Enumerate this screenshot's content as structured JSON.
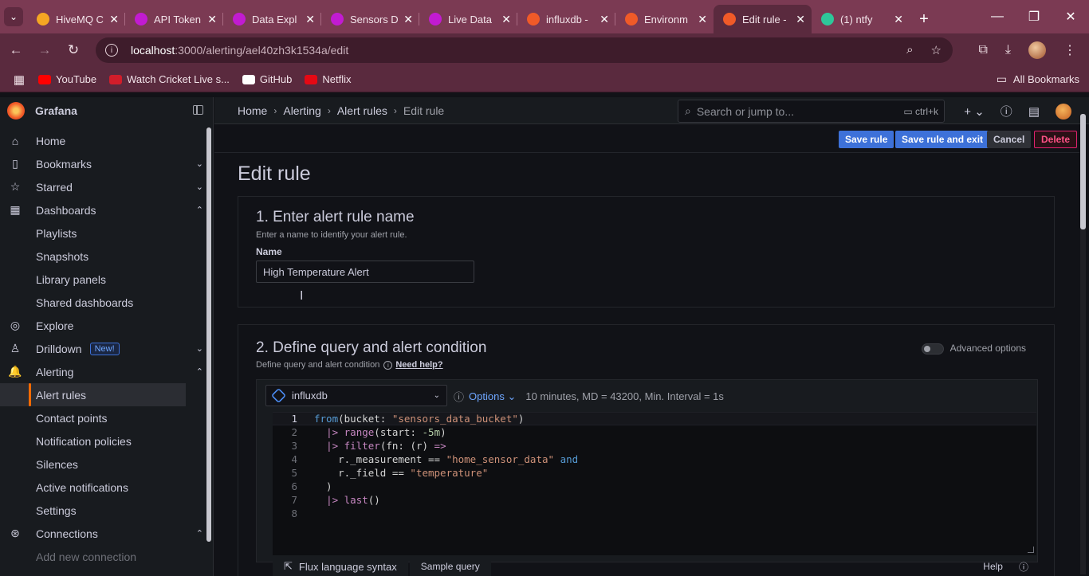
{
  "browser": {
    "tabs": [
      {
        "title": "HiveMQ C",
        "color": "#f5a623"
      },
      {
        "title": "API Token",
        "color": "#c21bd1"
      },
      {
        "title": "Data Expl",
        "color": "#c21bd1"
      },
      {
        "title": "Sensors D",
        "color": "#c21bd1"
      },
      {
        "title": "Live Data",
        "color": "#c21bd1"
      },
      {
        "title": "influxdb -",
        "color": "#f05a28"
      },
      {
        "title": "Environm",
        "color": "#f05a28"
      },
      {
        "title": "Edit rule -",
        "color": "#f05a28"
      },
      {
        "title": "(1) ntfy",
        "color": "#2ec79a"
      }
    ],
    "url_host": "localhost",
    "url_path": ":3000/alerting/ael40zh3k1534a/edit",
    "bookmarks": [
      {
        "label": "YouTube",
        "color": "#ff0000"
      },
      {
        "label": "Watch Cricket Live s...",
        "color": "#d11d2a"
      },
      {
        "label": "GitHub",
        "color": "#ffffff"
      },
      {
        "label": "Netflix",
        "color": "#e50914"
      }
    ],
    "all_bookmarks": "All Bookmarks"
  },
  "grafana": {
    "app_title": "Grafana",
    "sidebar": [
      {
        "label": "Home",
        "icon": "home-icon",
        "glyph": "⌂",
        "level": 0,
        "chev": ""
      },
      {
        "label": "Bookmarks",
        "icon": "bookmark-icon",
        "glyph": "▯",
        "level": 0,
        "chev": "⌄"
      },
      {
        "label": "Starred",
        "icon": "star-icon",
        "glyph": "☆",
        "level": 0,
        "chev": "⌄"
      },
      {
        "label": "Dashboards",
        "icon": "dashboards-icon",
        "glyph": "▦",
        "level": 0,
        "chev": "⌃"
      },
      {
        "label": "Playlists",
        "level": 1
      },
      {
        "label": "Snapshots",
        "level": 1
      },
      {
        "label": "Library panels",
        "level": 1
      },
      {
        "label": "Shared dashboards",
        "level": 1
      },
      {
        "label": "Explore",
        "icon": "explore-icon",
        "glyph": "◎",
        "level": 0,
        "chev": ""
      },
      {
        "label": "Drilldown",
        "icon": "drilldown-icon",
        "glyph": "♙",
        "level": 0,
        "chev": "⌄",
        "badge": "New!"
      },
      {
        "label": "Alerting",
        "icon": "bell-icon",
        "glyph": "🔔",
        "level": 0,
        "chev": "⌃"
      },
      {
        "label": "Alert rules",
        "level": 1,
        "active": true
      },
      {
        "label": "Contact points",
        "level": 1
      },
      {
        "label": "Notification policies",
        "level": 1
      },
      {
        "label": "Silences",
        "level": 1
      },
      {
        "label": "Active notifications",
        "level": 1
      },
      {
        "label": "Settings",
        "level": 1
      },
      {
        "label": "Connections",
        "icon": "connections-icon",
        "glyph": "⊛",
        "level": 0,
        "chev": "⌃"
      },
      {
        "label": "Add new connection",
        "level": 1,
        "muted": true
      }
    ],
    "breadcrumbs": [
      "Home",
      "Alerting",
      "Alert rules",
      "Edit rule"
    ],
    "search_placeholder": "Search or jump to...",
    "search_shortcut": "ctrl+k",
    "actions": {
      "save": "Save rule",
      "save_exit": "Save rule and exit",
      "cancel": "Cancel",
      "delete": "Delete"
    },
    "page_title": "Edit rule",
    "section1": {
      "title": "1. Enter alert rule name",
      "desc": "Enter a name to identify your alert rule.",
      "name_label": "Name",
      "name_value": "High Temperature Alert"
    },
    "section2": {
      "title": "2. Define query and alert condition",
      "desc": "Define query and alert condition",
      "help": "Need help?",
      "advanced": "Advanced options",
      "datasource": "influxdb",
      "options": "Options",
      "query_info": "10 minutes, MD = 43200, Min. Interval = 1s",
      "code_lines": [
        "1",
        "2",
        "3",
        "4",
        "5",
        "6",
        "7",
        "8"
      ],
      "bottom_tabs": [
        "Flux language syntax",
        "Sample query"
      ],
      "help_label": "Help"
    }
  }
}
